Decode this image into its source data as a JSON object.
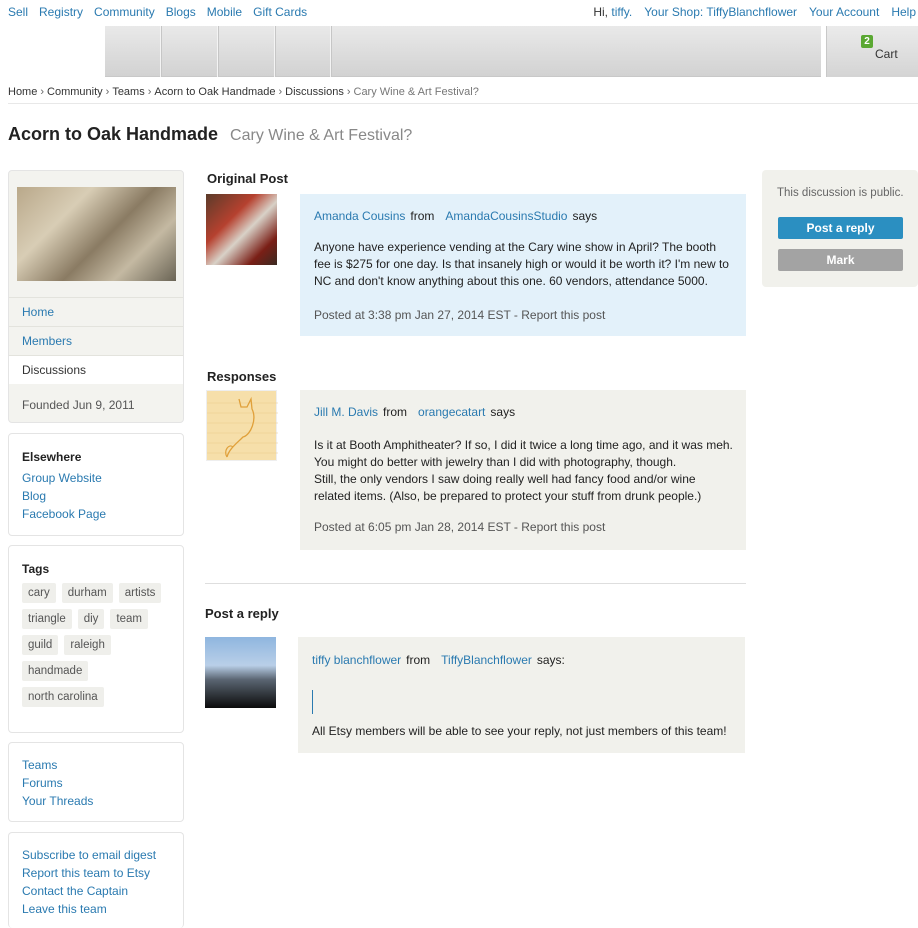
{
  "topnav": {
    "left": [
      "Sell",
      "Registry",
      "Community",
      "Blogs",
      "Mobile",
      "Gift Cards"
    ],
    "greeting": "Hi,",
    "username": "tiffy.",
    "shop": "Your Shop: TiffyBlanchflower",
    "account": "Your Account",
    "help": "Help"
  },
  "cart": {
    "count": "2",
    "label": "Cart"
  },
  "breadcrumb": {
    "items": [
      "Home",
      "Community",
      "Teams",
      "Acorn to Oak Handmade",
      "Discussions"
    ],
    "current": "Cary Wine & Art Festival?",
    "sep": "›"
  },
  "page": {
    "team_name": "Acorn to Oak Handmade",
    "topic": "Cary Wine & Art Festival?"
  },
  "sidebar": {
    "nav": [
      "Home",
      "Members",
      "Discussions"
    ],
    "founded": "Founded Jun 9, 2011",
    "elsewhere": {
      "title": "Elsewhere",
      "links": [
        "Group Website",
        "Blog",
        "Facebook Page"
      ]
    },
    "tags": {
      "title": "Tags",
      "items": [
        "cary",
        "durham",
        "artists",
        "triangle",
        "diy",
        "team",
        "guild",
        "raleigh",
        "handmade",
        "north carolina"
      ]
    },
    "teams_links": [
      "Teams",
      "Forums",
      "Your Threads"
    ],
    "actions": [
      "Subscribe to email digest",
      "Report this team to Etsy",
      "Contact the Captain",
      "Leave this team"
    ]
  },
  "original": {
    "heading": "Original Post",
    "author": "Amanda Cousins",
    "from": "from",
    "shop": "AmandaCousinsStudio",
    "says": "says",
    "body": "Anyone have experience vending at the Cary wine show in April? The booth fee is $275 for one day. Is that insanely high or would it be worth it? I'm new to NC and don't know anything about this one. 60 vendors, attendance 5000.",
    "posted": "Posted at 3:38 pm Jan 27, 2014 EST",
    "report": "Report this post"
  },
  "responses": {
    "heading": "Responses",
    "author": "Jill M. Davis",
    "from": "from",
    "shop": "orangecatart",
    "says": "says",
    "body1": "Is it at Booth Amphitheater? If so, I did it twice a long time ago, and it was meh. You might do better with jewelry than I did with photography, though.",
    "body2": "Still, the only vendors I saw doing really well had fancy food and/or wine related items. (Also, be prepared to protect your stuff from drunk people.)",
    "posted": "Posted at 6:05 pm Jan 28, 2014 EST",
    "report": "Report this post"
  },
  "reply": {
    "heading": "Post a reply",
    "author": "tiffy blanchflower",
    "from": "from",
    "shop": "TiffyBlanchflower",
    "says": "says:",
    "note": "All Etsy members will be able to see your reply, not just members of this team!"
  },
  "rail": {
    "public_note": "This discussion is public.",
    "post_reply": "Post a reply",
    "mark": "Mark"
  },
  "colors": {
    "link": "#2a7ab0",
    "primary_button": "#2b8fc1",
    "original_bg": "#e3f1fa"
  }
}
